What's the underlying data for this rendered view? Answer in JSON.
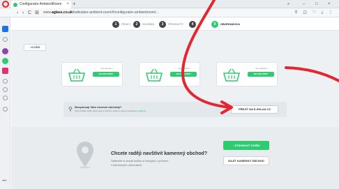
{
  "browser": {
    "tab_title": "Configurator AmbientRoom",
    "tab_close": "×",
    "new_tab": "+",
    "nav_back": "‹",
    "nav_forward": "›",
    "nav_reload": "C",
    "nav_speed": "⊞",
    "url_prefix": "www.",
    "url_domain": "aglass.co.uk",
    "url_path": "/kalkulator-ambient-room/#/configurator-ambientroom/...",
    "window_controls": {
      "minimize": "–",
      "maximize": "□",
      "close": "×"
    },
    "window_search": "⌕"
  },
  "steps": [
    {
      "num": "1",
      "label": "PRVKY"
    },
    {
      "num": "2",
      "label": "SCHÉMA"
    },
    {
      "num": "3",
      "label": "PRODUKTY"
    },
    {
      "num": "4",
      "label": ""
    },
    {
      "num": "5",
      "label": "OBJEDNÁVKA"
    }
  ],
  "back_button": "‹  KOŠÍK",
  "cards": [
    {
      "label": "Vše skladem",
      "button": "DO OBCHODU"
    },
    {
      "label": "Vše skladem",
      "button": "DO OBCHODU"
    },
    {
      "label": "Vše skladem",
      "button": "DO OBCHODU"
    }
  ],
  "warning": {
    "title": "Nevyhovují Vám vzorové obchody?",
    "text": "Tady můžete košík zkopírovat a vložit do svého e-shopu na adrese",
    "link": "eshop.cz",
    "button": "PŘEJÍT NA E-SHLAD.CZ"
  },
  "store": {
    "question": "Chcete raději navštívit kamenný obchod?",
    "desc1": "Stáhněte si obsah košíku a navigaci v pořízení",
    "desc2": "v kamenných obchodech.",
    "download_button": "↓  STÁHNOUT KOŠÍK",
    "find_button": "NAJÍT KAMENNÝ OBCHOD"
  },
  "colors": {
    "accent_green": "#2ecc71",
    "annotation_red": "#e3262f"
  },
  "icons": [
    "opera-logo-icon",
    "basket-icon",
    "pin-icon",
    "location-pin-icon"
  ]
}
